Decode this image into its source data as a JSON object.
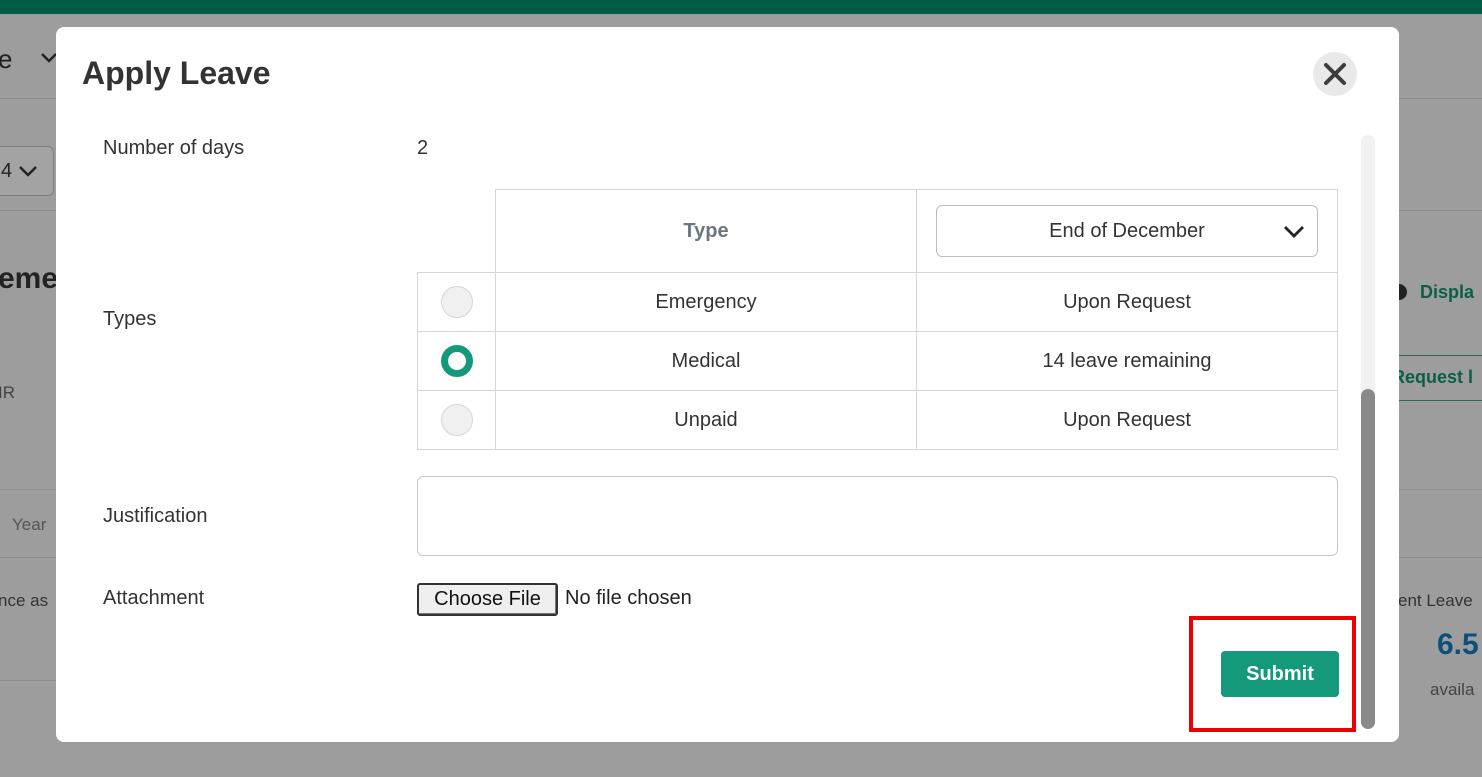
{
  "background": {
    "header_fragment": "e",
    "year_select_fragment": "4",
    "heading_fragment": "eme",
    "code_fragment": "IR",
    "col_year": "Year",
    "balance_fragment": "nce as",
    "display_fragment": "Displa",
    "request_fragment": "Request l",
    "current_leave_fragment": "ent Leave",
    "current_leave_value": "6.5",
    "available_fragment": "availa"
  },
  "modal": {
    "title": "Apply Leave",
    "number_of_days": {
      "label": "Number of days",
      "value": "2"
    },
    "types": {
      "label": "Types",
      "header_type": "Type",
      "period_select": {
        "selected": "End of December"
      },
      "rows": [
        {
          "name": "Emergency",
          "balance": "Upon Request",
          "selected": false
        },
        {
          "name": "Medical",
          "balance": "14 leave remaining",
          "selected": true
        },
        {
          "name": "Unpaid",
          "balance": "Upon Request",
          "selected": false
        }
      ]
    },
    "justification": {
      "label": "Justification",
      "value": ""
    },
    "attachment": {
      "label": "Attachment",
      "button": "Choose File",
      "status": "No file chosen"
    },
    "submit": "Submit"
  },
  "colors": {
    "accent": "#149a7b",
    "topbar": "#005c45",
    "highlight": "#ee0000"
  },
  "icons": {
    "close": "close-icon",
    "dropdown": "chevron-down-icon"
  }
}
